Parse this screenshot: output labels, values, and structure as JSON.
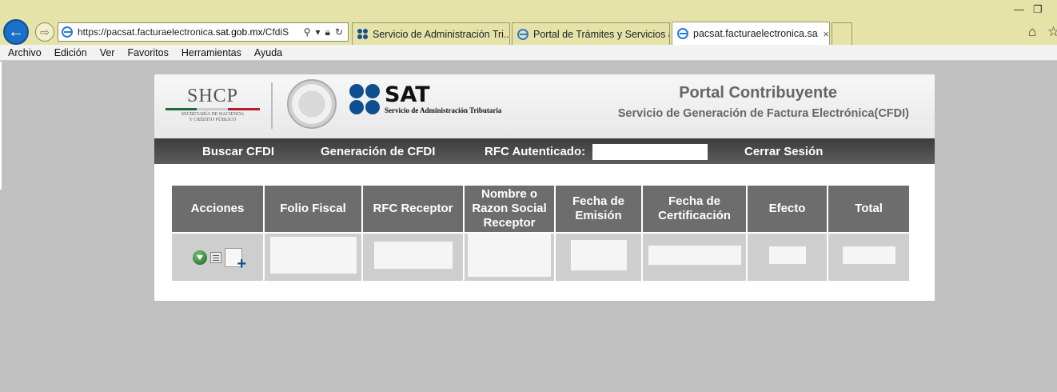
{
  "browser": {
    "url_prefix": "https://pacsat.facturaelectronica.",
    "url_domain": "sat.gob.mx",
    "url_suffix": "/CfdiS",
    "tabs": [
      {
        "label": "Servicio de Administración Tri..."
      },
      {
        "label": "Portal de Trámites y Servicios a..."
      },
      {
        "label": "pacsat.facturaelectronica.sa..."
      }
    ],
    "close_glyph": "×"
  },
  "menubar": {
    "items": [
      "Archivo",
      "Edición",
      "Ver",
      "Favoritos",
      "Herramientas",
      "Ayuda"
    ]
  },
  "header": {
    "shcp_title": "SHCP",
    "shcp_sub_line1": "SECRETARÍA DE HACIENDA",
    "shcp_sub_line2": "Y CRÉDITO PÚBLICO",
    "sat_name": "SAT",
    "sat_sub": "Servicio de Administración Tributaria",
    "portal_title": "Portal Contribuyente",
    "portal_subtitle": "Servicio de Generación de Factura Electrónica(CFDI)"
  },
  "navbar": {
    "buscar": "Buscar CFDI",
    "generacion": "Generación de CFDI",
    "rfc_label": "RFC Autenticado:",
    "cerrar": "Cerrar Sesión"
  },
  "table": {
    "headers": [
      "Acciones",
      "Folio Fiscal",
      "RFC Receptor",
      "Nombre o Razon Social Receptor",
      "Fecha de Emisión",
      "Fecha de Certificación",
      "Efecto",
      "Total"
    ]
  },
  "colors": {
    "chrome_bg": "#e6e3a8",
    "nav_dark": "#4a4a4a",
    "table_header": "#6d6d6d",
    "sat_blue": "#0e4f92"
  }
}
